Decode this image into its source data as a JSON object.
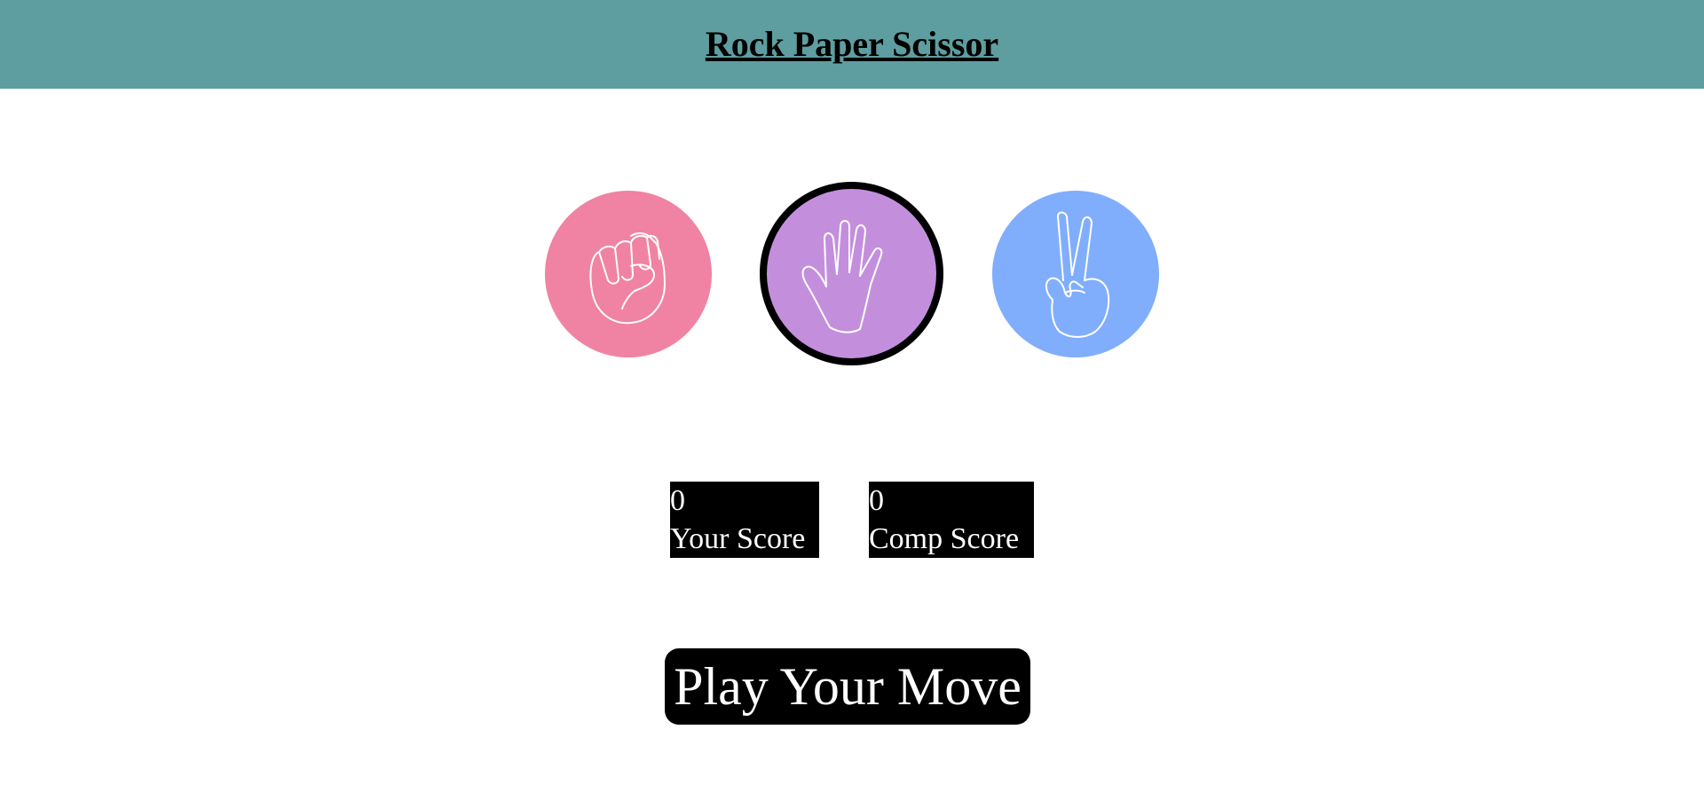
{
  "header": {
    "title": "Rock Paper Scissor",
    "bg_color": "#5f9ea0"
  },
  "choices": [
    {
      "id": "rock",
      "icon": "fist-icon",
      "color": "#f083a3",
      "selected": false
    },
    {
      "id": "paper",
      "icon": "open-hand-icon",
      "color": "#c38fdd",
      "selected": true
    },
    {
      "id": "scissor",
      "icon": "peace-hand-icon",
      "color": "#80aefc",
      "selected": false
    }
  ],
  "scores": {
    "user": {
      "value": "0",
      "label": "Your Score"
    },
    "comp": {
      "value": "0",
      "label": "Comp Score"
    }
  },
  "play_button": {
    "label": "Play Your Move"
  }
}
